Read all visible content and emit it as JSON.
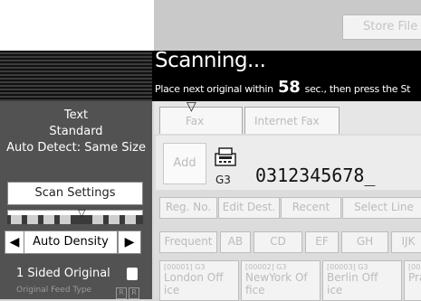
{
  "header": {
    "store_file_label": "Store File"
  },
  "status": {
    "title": "Scanning...",
    "message_prefix": "Place next original within",
    "seconds": "58",
    "message_suffix": "sec., then press the St"
  },
  "scan_summary": {
    "line1": "Text",
    "line2": "Standard",
    "line3": "Auto Detect: Same Size"
  },
  "scan_settings_label": "Scan Settings",
  "density": {
    "auto_label": "Auto Density",
    "lighter_glyph": "◀",
    "darker_glyph": "▶",
    "marker_glyph": "▽"
  },
  "original": {
    "sided_label": "1 Sided Original",
    "feed_type_label": "Original Feed Type"
  },
  "tabs": {
    "fax": "Fax",
    "internet_fax": "Internet Fax"
  },
  "destination": {
    "add_label": "Add",
    "line_type": "G3",
    "number": "0312345678_"
  },
  "tools": [
    "Reg. No.",
    "Edit Dest.",
    "Recent",
    "Select Line"
  ],
  "groups": [
    "Frequent",
    "AB",
    "CD",
    "EF",
    "GH",
    "IJK"
  ],
  "entries": [
    {
      "code": "[00001] G3",
      "name": "London Off",
      "sub": "ice"
    },
    {
      "code": "[00002] G3",
      "name": "NewYork Of",
      "sub": "fice"
    },
    {
      "code": "[00003] G3",
      "name": "Berlin Off",
      "sub": "ice"
    },
    {
      "code": "[00",
      "name": "Pra",
      "sub": ""
    }
  ],
  "colors": {
    "status_bar": "#000000",
    "left_panel": "#525252",
    "disabled_text": "#bbbbbb"
  }
}
